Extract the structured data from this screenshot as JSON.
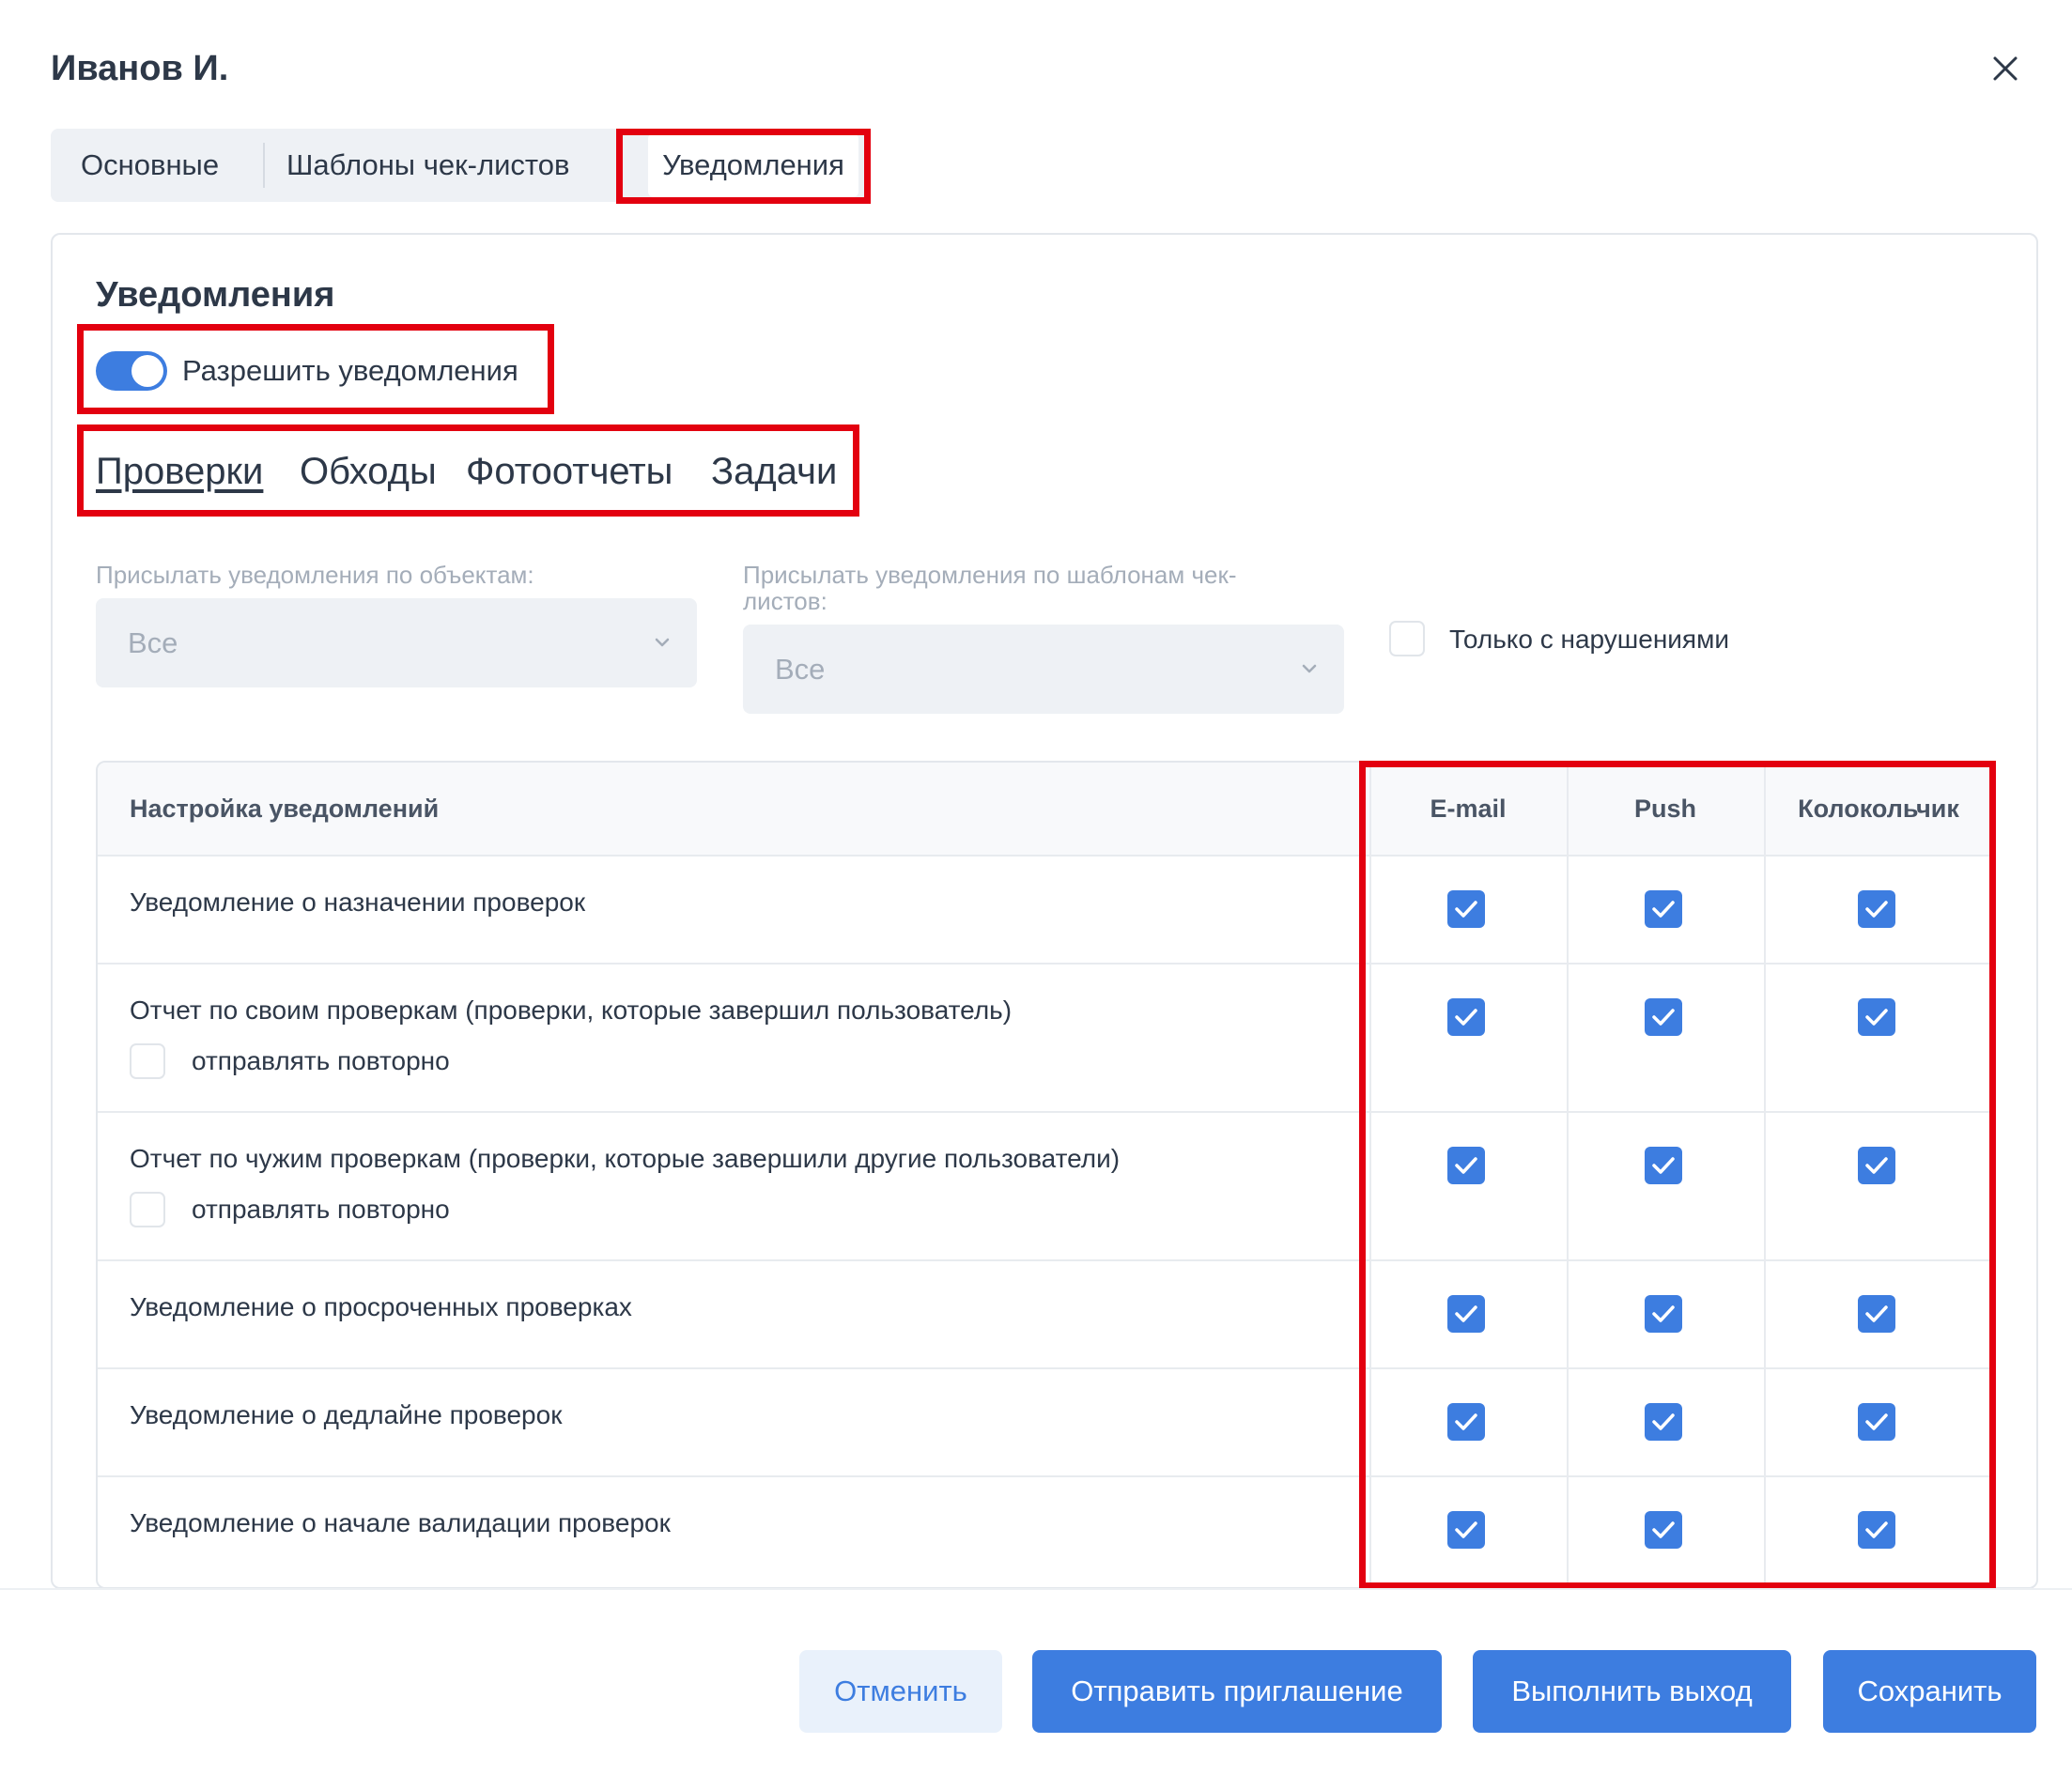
{
  "dialog": {
    "title": "Иванов И."
  },
  "tabs": [
    {
      "label": "Основные"
    },
    {
      "label": "Шаблоны чек-листов"
    },
    {
      "label": "Уведомления"
    }
  ],
  "section": {
    "title": "Уведомления"
  },
  "toggle": {
    "label": "Разрешить уведомления",
    "on": true
  },
  "subtabs": [
    {
      "label": "Проверки",
      "active": true
    },
    {
      "label": "Обходы"
    },
    {
      "label": "Фотоотчеты"
    },
    {
      "label": "Задачи"
    }
  ],
  "filters": {
    "objects_label": "Присылать уведомления по объектам:",
    "objects_value": "Все",
    "templates_label_line1": "Присылать уведомления по шаблонам чек-",
    "templates_label_line2": "листов:",
    "templates_value": "Все",
    "only_violations_label": "Только с нарушениями",
    "only_violations_checked": false
  },
  "table": {
    "headers": {
      "setting": "Настройка уведомлений",
      "email": "E-mail",
      "push": "Push",
      "bell": "Колокольчик"
    },
    "rows": [
      {
        "label": "Уведомление о назначении проверок",
        "email": true,
        "push": true,
        "bell": true
      },
      {
        "label": "Отчет по своим проверкам (проверки, которые завершил пользователь)",
        "resend_label": "отправлять повторно",
        "resend_checked": false,
        "email": true,
        "push": true,
        "bell": true
      },
      {
        "label": "Отчет по чужим проверкам (проверки, которые завершили другие пользователи)",
        "resend_label": "отправлять повторно",
        "resend_checked": false,
        "email": true,
        "push": true,
        "bell": true
      },
      {
        "label": "Уведомление о просроченных проверках",
        "email": true,
        "push": true,
        "bell": true
      },
      {
        "label": "Уведомление о дедлайне проверок",
        "email": true,
        "push": true,
        "bell": true
      },
      {
        "label": "Уведомление о начале валидации проверок",
        "email": true,
        "push": true,
        "bell": true
      }
    ]
  },
  "footer": {
    "cancel": "Отменить",
    "invite": "Отправить приглашение",
    "logout": "Выполнить выход",
    "save": "Сохранить"
  },
  "colors": {
    "accent": "#3d7de0",
    "highlight": "#e3000f"
  }
}
